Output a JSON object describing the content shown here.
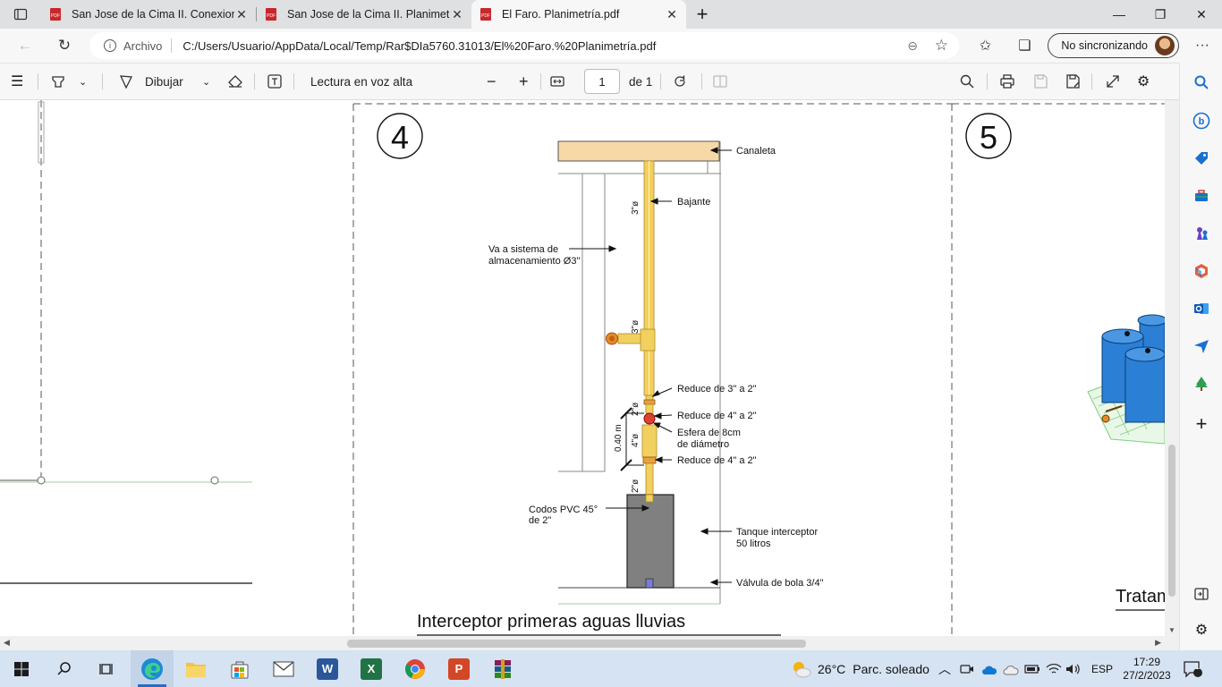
{
  "tabs": [
    {
      "title": "San Jose de la Cima II. Conexiones",
      "active": false
    },
    {
      "title": "San Jose de la Cima II. Planimetría",
      "active": false
    },
    {
      "title": "El Faro. Planimetría.pdf",
      "active": true
    }
  ],
  "address": {
    "scheme": "Archivo",
    "url": "C:/Users/Usuario/AppData/Local/Temp/Rar$DIa5760.31013/El%20Faro.%20Planimetría.pdf"
  },
  "profile": {
    "sync_label": "No sincronizando"
  },
  "pdf_toolbar": {
    "draw_label": "Dibujar",
    "read_aloud_label": "Lectura en voz alta",
    "page_current": "1",
    "page_total": "de 1"
  },
  "drawing": {
    "section_4_number": "4",
    "section_5_number": "5",
    "title": "Interceptor primeras aguas lluvias",
    "partial_title_right": "Tratam",
    "labels": {
      "canaleta": "Canaleta",
      "bajante": "Bajante",
      "va_a_sistema_1": "Va a sistema de",
      "va_a_sistema_2": "almacenamiento Ø3\"",
      "reduce_3_2": "Reduce de 3\" a 2\"",
      "reduce_4_2_a": "Reduce de 4\" a 2\"",
      "esfera_1": "Esfera de 8cm",
      "esfera_2": "de diámetro",
      "reduce_4_2_b": "Reduce de 4\" a 2\"",
      "codos_1": "Codos PVC 45°",
      "codos_2": "de 2\"",
      "tanque_1": "Tanque interceptor",
      "tanque_2": "50 litros",
      "valvula": "Válvula de bola 3/4\"",
      "dim_3a": "3\"ø",
      "dim_3b": "3\"ø",
      "dim_2a": "2\"ø",
      "dim_4": "4\"ø",
      "dim_2b": "2\"ø",
      "dim_040": "0.40 m"
    }
  },
  "taskbar": {
    "weather_temp": "26°C",
    "weather_desc": "Parc. soleado",
    "language": "ESP",
    "time": "17:29",
    "date": "27/2/2023",
    "notifications": "1"
  },
  "colors": {
    "pipe_yellow": "#f2d060",
    "canaleta_fill": "#f7d9a8",
    "tank_gray": "#808080",
    "tank_blue": "#2b7fd4",
    "taskbar_bg": "#d6e3f2"
  }
}
